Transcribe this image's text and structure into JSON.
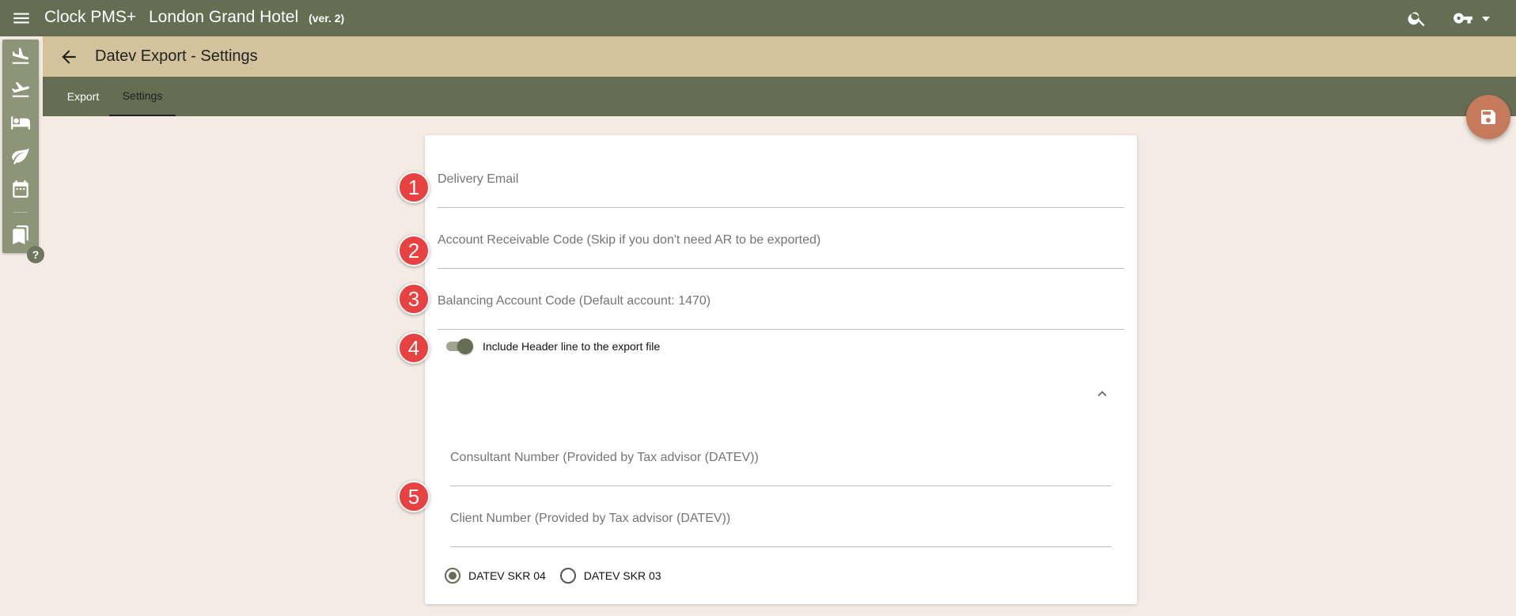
{
  "topbar": {
    "app_name": "Clock PMS+",
    "hotel_name": "London Grand Hotel",
    "version": "(ver. 2)",
    "icons": [
      "menu-icon",
      "search-icon",
      "key-icon",
      "caret-down-icon"
    ]
  },
  "sidebar": {
    "items": [
      "flight-land-icon",
      "flight-takeoff-icon",
      "bed-icon",
      "leaf-icon",
      "calendar-icon",
      "bookmarks-icon"
    ],
    "help": "?"
  },
  "header": {
    "title": "Datev Export - Settings"
  },
  "tabs": [
    {
      "label": "Export",
      "active": false
    },
    {
      "label": "Settings",
      "active": true
    }
  ],
  "form": {
    "delivery_email": {
      "label": "Delivery Email",
      "value": ""
    },
    "ar_code": {
      "label": "Account Receivable Code (Skip if you don't need AR to be exported)",
      "value": ""
    },
    "balancing_code": {
      "label": "Balancing Account Code (Default account: 1470)",
      "value": ""
    },
    "header_toggle": {
      "label": "Include Header line to the export file",
      "checked": true
    },
    "consultant_number": {
      "label": "Consultant Number (Provided by Tax advisor (DATEV))",
      "value": ""
    },
    "client_number": {
      "label": "Client Number (Provided by Tax advisor (DATEV))",
      "value": ""
    },
    "skr_options": [
      {
        "label": "DATEV SKR 04",
        "checked": true
      },
      {
        "label": "DATEV SKR 03",
        "checked": false
      }
    ]
  },
  "annotations": [
    "1",
    "2",
    "3",
    "4",
    "5"
  ],
  "colors": {
    "topbar": "#656d53",
    "subheader": "#d4c29d",
    "background": "#f4ece4",
    "fab": "#c57a5b",
    "badge": "#e84141"
  }
}
